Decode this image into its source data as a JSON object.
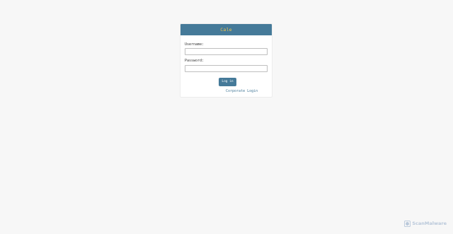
{
  "login": {
    "title": "Cale",
    "username_label": "Username:",
    "username_value": "",
    "password_label": "Password:",
    "password_value": "",
    "submit_label": "Log in",
    "corporate_link": "Corporate Login"
  },
  "watermark": {
    "icon": "scanmalware-logo-icon",
    "text": "ScanMalware"
  },
  "colors": {
    "background": "#f7f7f7",
    "header": "#457a99",
    "title": "#f1c44c",
    "button": "#457a99",
    "link": "#457a99"
  }
}
